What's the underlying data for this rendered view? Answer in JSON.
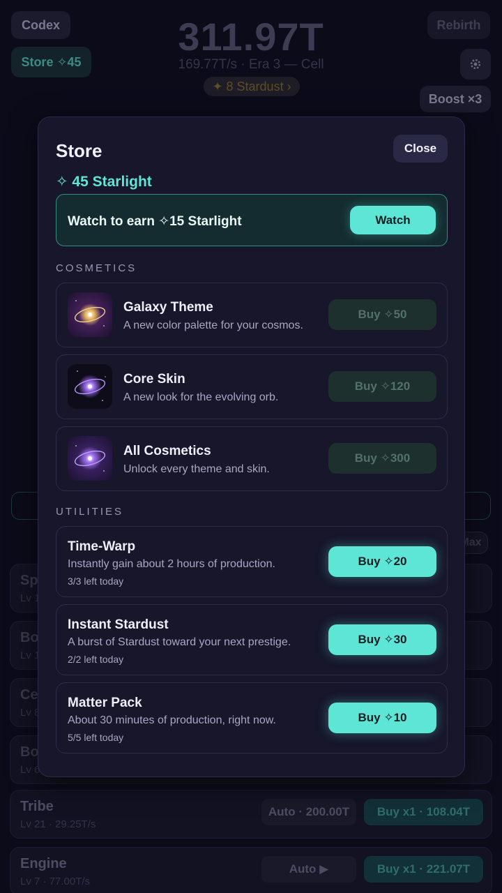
{
  "background": {
    "codex_label": "Codex",
    "store_label": "Store ✧45",
    "rebirth_label": "Rebirth",
    "settings_icon": "gear-icon",
    "boost_label": "Boost ×3",
    "total": "311.97T",
    "rate_line": "169.77T/s · Era 3 — Cell",
    "stardust_label": "✦ 8 Stardust ›",
    "max_label": "Max",
    "generators": [
      {
        "name": "Spa",
        "level": "Lv 1"
      },
      {
        "name": "Bo",
        "level": "Lv 1"
      },
      {
        "name": "Cel",
        "level": "Lv 8"
      },
      {
        "name": "Bo",
        "level": "Lv 6"
      },
      {
        "name": "Tribe",
        "level": "Lv 21 · 29.25T/s",
        "auto": "Auto · 200.00T",
        "buy": "Buy x1 · 108.04T"
      },
      {
        "name": "Engine",
        "level": "Lv 7 · 77.00T/s",
        "auto": "Auto ▶",
        "buy": "Buy x1 · 221.07T"
      }
    ]
  },
  "store": {
    "title": "Store",
    "close_label": "Close",
    "balance": "✧ 45 Starlight",
    "watch": {
      "text": "Watch to earn ✧15 Starlight",
      "button": "Watch"
    },
    "cosmetics_heading": "COSMETICS",
    "cosmetics": [
      {
        "title": "Galaxy Theme",
        "desc": "A new color palette for your cosmos.",
        "buy": "Buy ✧50",
        "icon": "galaxy-theme-icon"
      },
      {
        "title": "Core Skin",
        "desc": "A new look for the evolving orb.",
        "buy": "Buy ✧120",
        "icon": "core-skin-icon"
      },
      {
        "title": "All Cosmetics",
        "desc": "Unlock every theme and skin.",
        "buy": "Buy ✧300",
        "icon": "all-cosmetics-icon"
      }
    ],
    "utilities_heading": "UTILITIES",
    "utilities": [
      {
        "title": "Time-Warp",
        "desc": "Instantly gain about 2 hours of production.",
        "left": "3/3 left today",
        "buy": "Buy ✧20"
      },
      {
        "title": "Instant Stardust",
        "desc": "A burst of Stardust toward your next prestige.",
        "left": "2/2 left today",
        "buy": "Buy ✧30"
      },
      {
        "title": "Matter Pack",
        "desc": "About 30 minutes of production, right now.",
        "left": "5/5 left today",
        "buy": "Buy ✧10"
      }
    ]
  },
  "colors": {
    "accent": "#5de6d6",
    "modal_bg": "#17162b",
    "page_bg": "#0c0b1a"
  }
}
